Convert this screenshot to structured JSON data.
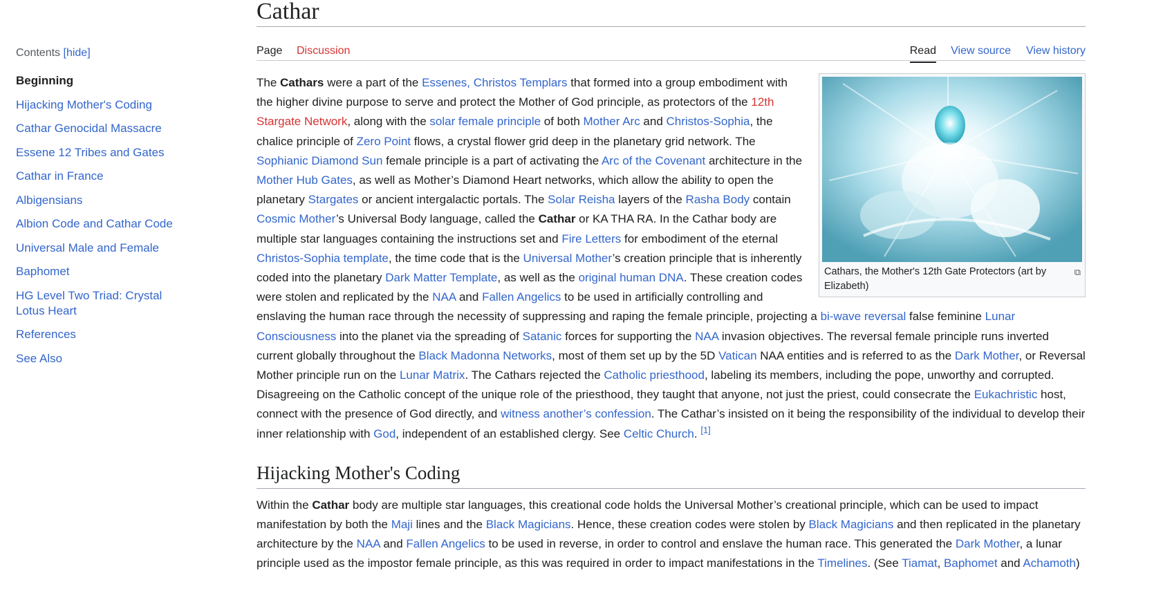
{
  "toc": {
    "label": "Contents",
    "hide": "[hide]",
    "items": [
      "Beginning",
      "Hijacking Mother's Coding",
      "Cathar Genocidal Massacre",
      "Essene 12 Tribes and Gates",
      "Cathar in France",
      "Albigensians",
      "Albion Code and Cathar Code",
      "Universal Male and Female",
      "Baphomet",
      "HG Level Two Triad: Crystal Lotus Heart",
      "References",
      "See Also"
    ]
  },
  "title": "Cathar",
  "tabs": {
    "page": "Page",
    "discussion": "Discussion",
    "read": "Read",
    "view_source": "View source",
    "view_history": "View history"
  },
  "thumb": {
    "caption": "Cathars, the Mother's 12th Gate Protectors (art by Elizabeth)",
    "magnify_icon": "magnify-clip-icon"
  },
  "section2_heading": "Hijacking Mother's Coding",
  "p1": [
    "The ",
    "Cathars",
    " were a part of the ",
    "Essenes, Christos Templars",
    " that formed into a group embodiment with the higher divine purpose to serve and protect the Mother of God principle, as protectors of the ",
    "12th Stargate Network",
    ", along with the ",
    "solar female principle",
    " of both ",
    "Mother Arc",
    " and ",
    "Christos-Sophia",
    ", the chalice principle of ",
    "Zero Point",
    " flows, a crystal flower grid deep in the planetary grid network. The ",
    "Sophianic Diamond Sun",
    " female principle is a part of activating the ",
    "Arc of the Covenant",
    " architecture in the ",
    "Mother Hub Gates",
    ", as well as Mother’s Diamond Heart networks, which allow the ability to open the planetary ",
    "Stargates",
    " or ancient intergalactic portals. The ",
    "Solar Reisha",
    " layers of the ",
    "Rasha Body",
    " contain ",
    "Cosmic Mother",
    "’s Universal Body language, called the ",
    "Cathar",
    " or KA THA RA. In the Cathar body are multiple star languages containing the instructions set and ",
    "Fire Letters",
    " for embodiment of the eternal ",
    "Christos-Sophia template",
    ", the time code that is the ",
    "Universal Mother",
    "’s creation principle that is inherently coded into the planetary ",
    "Dark Matter Template",
    ", as well as the ",
    "original human DNA",
    ". These creation codes were stolen and replicated by the ",
    "NAA",
    " and ",
    "Fallen Angelics",
    " to be used in artificially controlling and enslaving the human race through the necessity of suppressing and raping the female principle, projecting a ",
    "bi-wave reversal",
    " false feminine ",
    "Lunar Consciousness",
    " into the planet via the spreading of ",
    "Satanic",
    " forces for supporting the ",
    "NAA",
    " invasion objectives. The reversal female principle runs inverted current globally throughout the ",
    "Black Madonna Networks",
    ", most of them set up by the 5D ",
    "Vatican",
    " NAA entities and is referred to as the ",
    "Dark Mother",
    ", or Reversal Mother principle run on the ",
    "Lunar Matrix",
    ". The Cathars rejected the ",
    "Catholic priesthood",
    ", labeling its members, including the pope, unworthy and corrupted. Disagreeing on the Catholic concept of the unique role of the priesthood, they taught that anyone, not just the priest, could consecrate the ",
    "Eukachristic",
    " host, connect with the presence of God directly, and ",
    "witness another’s confession",
    ". The Cathar’s insisted on it being the responsibility of the individual to develop their inner relationship with ",
    "God",
    ", independent of an established clergy. See ",
    "Celtic Church",
    ". ",
    "[1]"
  ],
  "p2": [
    "Within the ",
    "Cathar",
    " body are multiple star languages, this creational code holds the Universal Mother’s creational principle, which can be used to impact manifestation by both the ",
    "Maji",
    " lines and the ",
    "Black Magicians",
    ". Hence, these creation codes were stolen by ",
    "Black Magicians",
    " and then replicated in the planetary architecture by the ",
    "NAA",
    " and ",
    "Fallen Angelics",
    " to be used in reverse, in order to control and enslave the human race. This generated the ",
    "Dark Mother",
    ", a lunar principle used as the impostor female principle, as this was required in order to impact manifestations in the ",
    "Timelines",
    ". (See ",
    "Tiamat",
    ", ",
    "Baphomet",
    " and ",
    "Achamoth",
    ")"
  ]
}
